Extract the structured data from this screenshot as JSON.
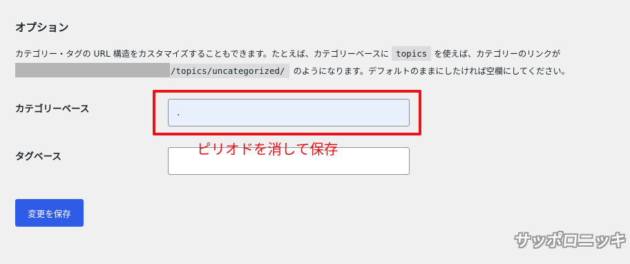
{
  "section": {
    "title": "オプション"
  },
  "description": {
    "line1_before": "カテゴリー・タグの URL 構造をカスタマイズすることもできます。たとえば、カテゴリーベースに",
    "example_base": "topics",
    "line1_after": "を使えば、カテゴリーのリンクが",
    "example_url_tail": "/topics/uncategorized/",
    "line2_after": "のようになります。デフォルトのままにしたければ空欄にしてください。"
  },
  "fields": {
    "category_base": {
      "label": "カテゴリーベース",
      "value": "."
    },
    "tag_base": {
      "label": "タグベース",
      "value": ""
    }
  },
  "annotation": {
    "text": "ピリオドを消して保存",
    "color": "#e8141a"
  },
  "save_button": {
    "label": "変更を保存",
    "color": "#2e5ce7"
  },
  "watermark": {
    "text": "サッポロニッキ"
  }
}
